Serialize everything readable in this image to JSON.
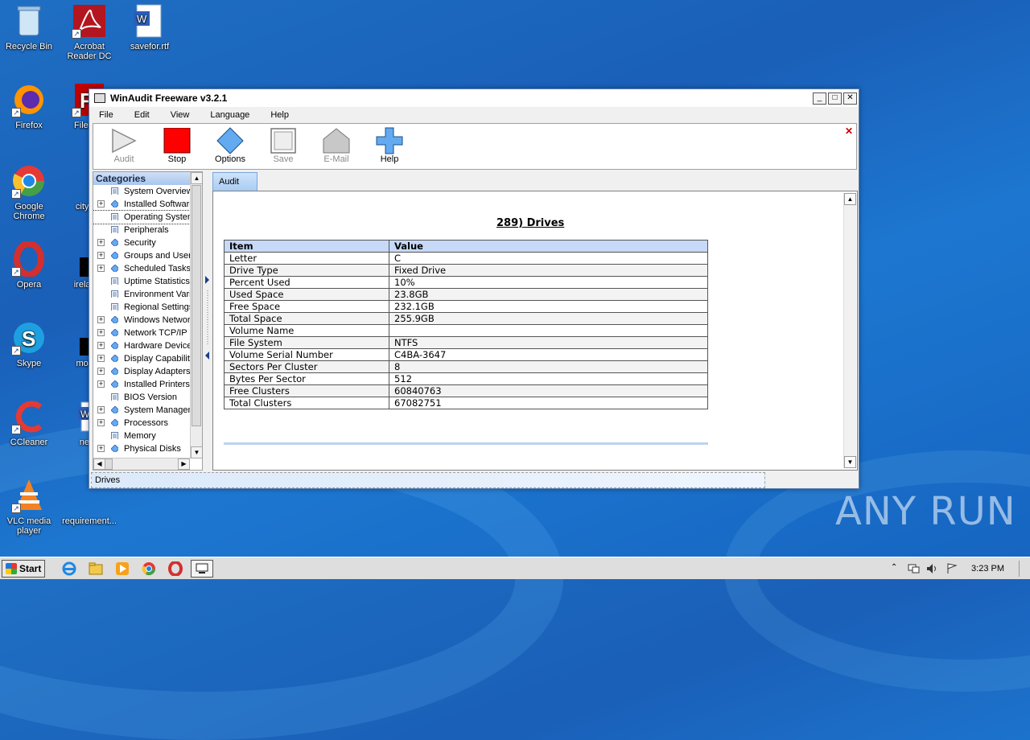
{
  "desktop": {
    "icons": [
      {
        "label": "Recycle Bin"
      },
      {
        "label": "Acrobat Reader DC"
      },
      {
        "label": "savefor.rtf"
      },
      {
        "label": "Firefox"
      },
      {
        "label": "FileZilla"
      },
      {
        "label": "Google Chrome"
      },
      {
        "label": "cityexp"
      },
      {
        "label": "Opera"
      },
      {
        "label": "irelandy"
      },
      {
        "label": "Skype"
      },
      {
        "label": "monito"
      },
      {
        "label": "CCleaner"
      },
      {
        "label": "netto"
      },
      {
        "label": "VLC media player"
      },
      {
        "label": "requirement..."
      }
    ],
    "watermark": "ANY RUN"
  },
  "window": {
    "title": "WinAudit Freeware v3.2.1",
    "menu": [
      "File",
      "Edit",
      "View",
      "Language",
      "Help"
    ],
    "toolbar": [
      {
        "label": "Audit",
        "icon": "play-icon",
        "enabled": false
      },
      {
        "label": "Stop",
        "icon": "stop-icon",
        "enabled": true
      },
      {
        "label": "Options",
        "icon": "diamond-icon",
        "enabled": true
      },
      {
        "label": "Save",
        "icon": "save-icon",
        "enabled": false
      },
      {
        "label": "E-Mail",
        "icon": "email-icon",
        "enabled": false
      },
      {
        "label": "Help",
        "icon": "plus-help-icon",
        "enabled": true
      }
    ],
    "categories_header": "Categories",
    "categories": [
      {
        "label": "System Overview",
        "expandable": false,
        "icon": "doc"
      },
      {
        "label": "Installed Software",
        "expandable": true,
        "icon": "diamond"
      },
      {
        "label": "Operating System",
        "expandable": false,
        "icon": "doc",
        "selected": true
      },
      {
        "label": "Peripherals",
        "expandable": false,
        "icon": "doc"
      },
      {
        "label": "Security",
        "expandable": true,
        "icon": "diamond"
      },
      {
        "label": "Groups and Users",
        "expandable": true,
        "icon": "diamond"
      },
      {
        "label": "Scheduled Tasks",
        "expandable": true,
        "icon": "diamond"
      },
      {
        "label": "Uptime Statistics",
        "expandable": false,
        "icon": "doc"
      },
      {
        "label": "Environment Variables",
        "expandable": false,
        "icon": "doc"
      },
      {
        "label": "Regional Settings",
        "expandable": false,
        "icon": "doc"
      },
      {
        "label": "Windows Network",
        "expandable": true,
        "icon": "diamond"
      },
      {
        "label": "Network TCP/IP",
        "expandable": true,
        "icon": "diamond"
      },
      {
        "label": "Hardware Devices",
        "expandable": true,
        "icon": "diamond"
      },
      {
        "label": "Display Capabilities",
        "expandable": true,
        "icon": "diamond"
      },
      {
        "label": "Display Adapters",
        "expandable": true,
        "icon": "diamond"
      },
      {
        "label": "Installed Printers",
        "expandable": true,
        "icon": "diamond"
      },
      {
        "label": "BIOS Version",
        "expandable": false,
        "icon": "doc"
      },
      {
        "label": "System Management",
        "expandable": true,
        "icon": "diamond"
      },
      {
        "label": "Processors",
        "expandable": true,
        "icon": "diamond"
      },
      {
        "label": "Memory",
        "expandable": false,
        "icon": "doc"
      },
      {
        "label": "Physical Disks",
        "expandable": true,
        "icon": "diamond"
      }
    ],
    "tab": "Audit",
    "report": {
      "title": "289) Drives",
      "columns": [
        "Item",
        "Value"
      ],
      "rows": [
        [
          "Letter",
          "C"
        ],
        [
          "Drive Type",
          "Fixed Drive"
        ],
        [
          "Percent Used",
          "10%"
        ],
        [
          "Used Space",
          "23.8GB"
        ],
        [
          "Free Space",
          "232.1GB"
        ],
        [
          "Total Space",
          "255.9GB"
        ],
        [
          "Volume Name",
          ""
        ],
        [
          "File System",
          "NTFS"
        ],
        [
          "Volume Serial Number",
          "C4BA-3647"
        ],
        [
          "Sectors Per Cluster",
          "8"
        ],
        [
          "Bytes Per Sector",
          "512"
        ],
        [
          "Free Clusters",
          "60840763"
        ],
        [
          "Total Clusters",
          "67082751"
        ]
      ]
    },
    "status": "Drives"
  },
  "taskbar": {
    "start_label": "Start",
    "clock": "3:23 PM"
  },
  "colors": {
    "accent_header": "#c6d9f7",
    "stop_red": "#ff0000",
    "diamond_blue": "#64aaf0"
  }
}
